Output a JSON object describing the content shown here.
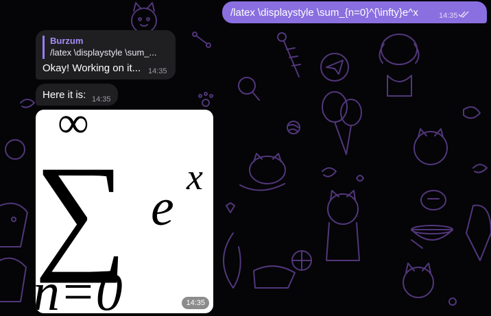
{
  "colors": {
    "background": "#050407",
    "doodle": "#5a3d88",
    "outgoing_bubble": "#8a6fe0",
    "incoming_bubble": "#1f1f22",
    "reply_accent": "#9a7cf0"
  },
  "outgoing_message": {
    "text": "/latex \\displaystyle \\sum_{n=0}^{\\infty}e^x",
    "time": "14:35",
    "status_icon": "double-check-icon"
  },
  "reply_message": {
    "quoted_author": "Burzum",
    "quoted_text": "/latex \\displaystyle \\sum_...",
    "text": "Okay! Working on it...",
    "time": "14:35"
  },
  "result_message": {
    "text": "Here it is:",
    "time": "14:35"
  },
  "rendered_image": {
    "formula_superscript": "∞",
    "formula_operator": "∑",
    "formula_base": "e",
    "formula_exponent": "x",
    "formula_subscript": "n=0",
    "time": "14:35"
  }
}
